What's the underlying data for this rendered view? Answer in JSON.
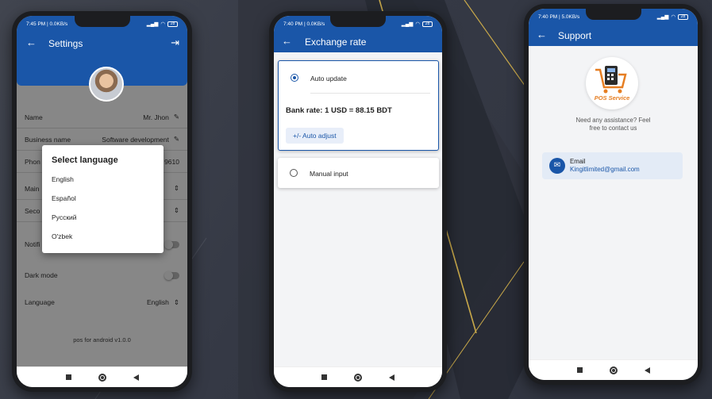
{
  "phone1": {
    "status": {
      "time": "7:45 PM | 0.0KB/s",
      "battery": "28"
    },
    "title": "Settings",
    "rows": [
      {
        "label": "Name",
        "value": "Mr. Jhon"
      },
      {
        "label": "Business name",
        "value": "Software development"
      },
      {
        "label": "Phon",
        "value": "9610"
      },
      {
        "label": "Main",
        "value": ""
      },
      {
        "label": "Seco",
        "value": ""
      },
      {
        "label": "Notifi",
        "value": ""
      },
      {
        "label": "Dark mode",
        "value": ""
      },
      {
        "label": "Language",
        "value": "English"
      }
    ],
    "version": "pos for android v1.0.0",
    "dialog": {
      "title": "Select language",
      "options": [
        "English",
        "Español",
        "Русский",
        "O'zbek"
      ]
    }
  },
  "phone2": {
    "status": {
      "time": "7:40 PM | 0.0KB/s",
      "battery": "28"
    },
    "title": "Exchange rate",
    "auto_update": "Auto update",
    "bank_rate": "Bank rate: 1 USD = 88.15 BDT",
    "auto_adjust": "+/- Auto adjust",
    "manual_input": "Manual input",
    "selected": "auto_update"
  },
  "phone3": {
    "status": {
      "time": "7:40 PM | 5.0KB/s",
      "battery": "28"
    },
    "title": "Support",
    "logo_text": "POS Service",
    "help_text_1": "Need any assistance? Feel",
    "help_text_2": "free to contact us",
    "email_label": "Email",
    "email_value": "Kingitlimited@gmail.com"
  },
  "colors": {
    "appbar": "#1a56a8",
    "background": "#353945",
    "accent_gold": "#c9a94a"
  }
}
